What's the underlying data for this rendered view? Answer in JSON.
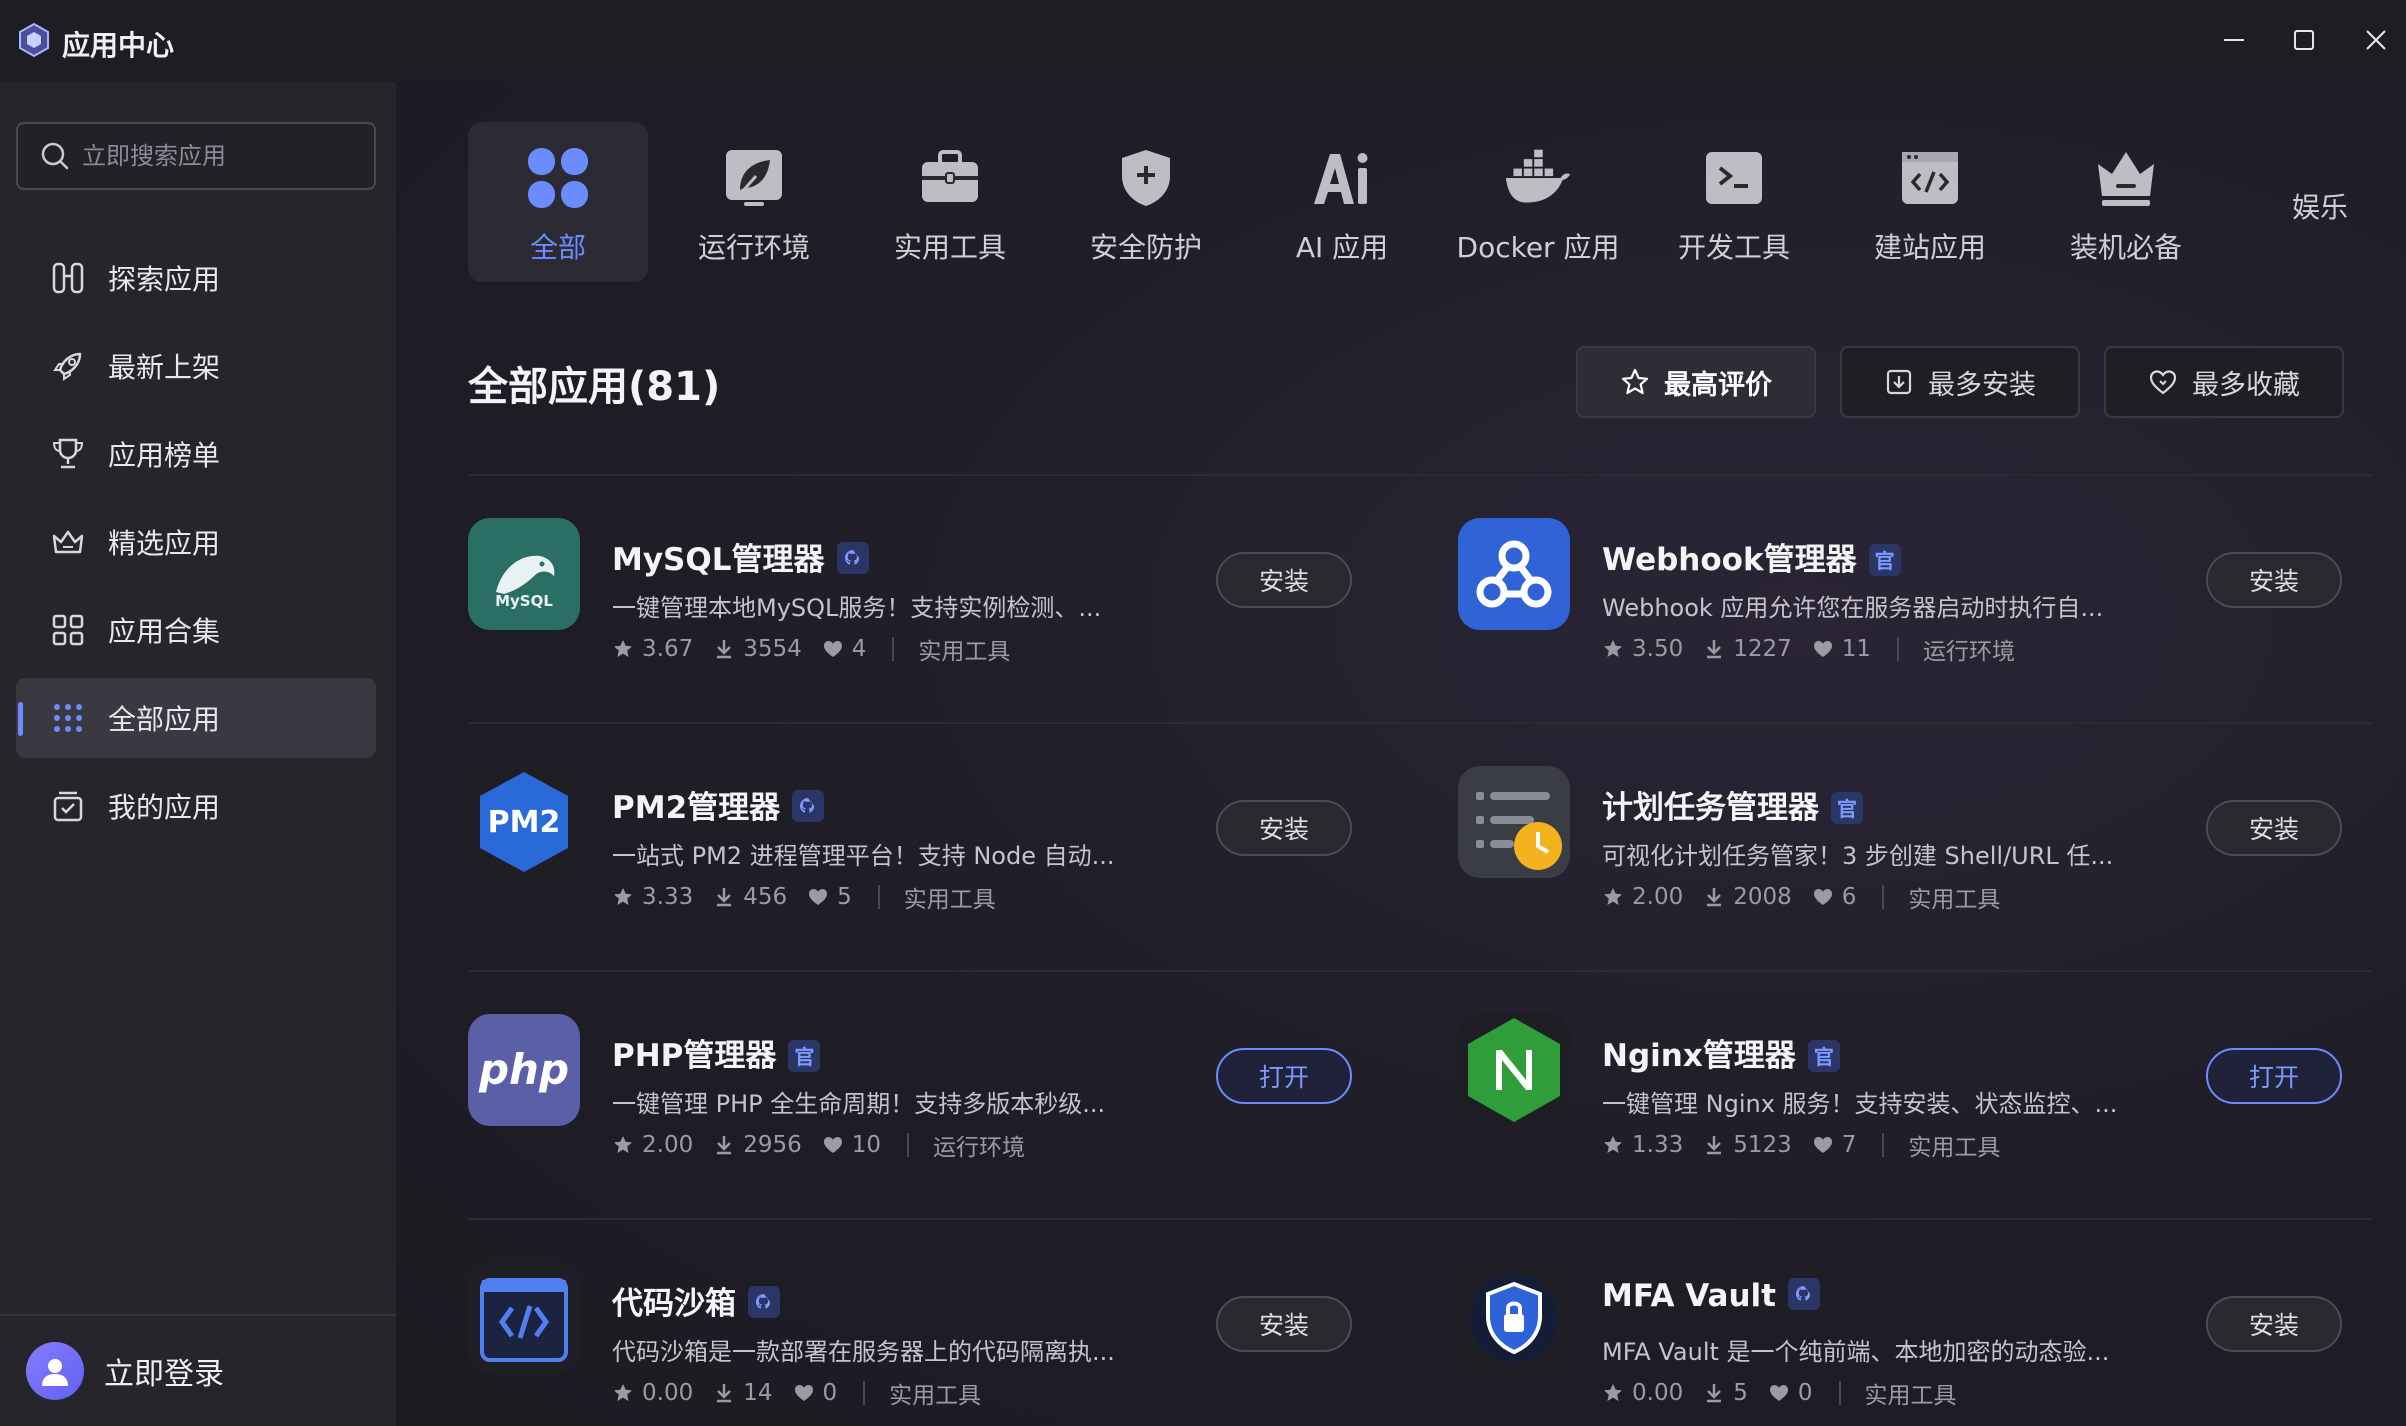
{
  "window": {
    "title": "应用中心"
  },
  "search": {
    "placeholder": "立即搜索应用"
  },
  "sidebar": {
    "items": [
      {
        "label": "探索应用",
        "icon": "explore-icon"
      },
      {
        "label": "最新上架",
        "icon": "rocket-icon"
      },
      {
        "label": "应用榜单",
        "icon": "trophy-icon"
      },
      {
        "label": "精选应用",
        "icon": "crown-basket-icon"
      },
      {
        "label": "应用合集",
        "icon": "grid-icon"
      },
      {
        "label": "全部应用",
        "icon": "dots-grid-icon",
        "active": true
      },
      {
        "label": "我的应用",
        "icon": "my-apps-icon"
      }
    ],
    "login_label": "立即登录"
  },
  "categories": [
    {
      "label": "全部",
      "icon": "clover-icon",
      "active": true
    },
    {
      "label": "运行环境",
      "icon": "leaf-icon"
    },
    {
      "label": "实用工具",
      "icon": "toolbox-icon"
    },
    {
      "label": "安全防护",
      "icon": "shield-icon"
    },
    {
      "label": "AI 应用",
      "icon": "ai-icon"
    },
    {
      "label": "Docker 应用",
      "icon": "docker-icon"
    },
    {
      "label": "开发工具",
      "icon": "terminal-icon"
    },
    {
      "label": "建站应用",
      "icon": "code-window-icon"
    },
    {
      "label": "装机必备",
      "icon": "crown-icon"
    }
  ],
  "categories_more": "娱乐",
  "section": {
    "title": "全部应用(81)"
  },
  "sort": {
    "top_rated": "最高评价",
    "most_installed": "最多安装",
    "most_favorited": "最多收藏"
  },
  "apps": [
    {
      "name": "MySQL管理器",
      "badge": "github",
      "desc": "一键管理本地MySQL服务！支持实例检测、...",
      "rating": "3.67",
      "installs": "3554",
      "likes": "4",
      "category": "实用工具",
      "action": "安装"
    },
    {
      "name": "Webhook管理器",
      "badge": "官",
      "desc": "Webhook 应用允许您在服务器启动时执行自...",
      "rating": "3.50",
      "installs": "1227",
      "likes": "11",
      "category": "运行环境",
      "action": "安装"
    },
    {
      "name": "PM2管理器",
      "badge": "github",
      "desc": "一站式 PM2 进程管理平台！支持 Node 自动...",
      "rating": "3.33",
      "installs": "456",
      "likes": "5",
      "category": "实用工具",
      "action": "安装"
    },
    {
      "name": "计划任务管理器",
      "badge": "官",
      "desc": "可视化计划任务管家！3 步创建 Shell/URL 任...",
      "rating": "2.00",
      "installs": "2008",
      "likes": "6",
      "category": "实用工具",
      "action": "安装"
    },
    {
      "name": "PHP管理器",
      "badge": "官",
      "desc": "一键管理 PHP 全生命周期！支持多版本秒级...",
      "rating": "2.00",
      "installs": "2956",
      "likes": "10",
      "category": "运行环境",
      "action": "打开"
    },
    {
      "name": "Nginx管理器",
      "badge": "官",
      "desc": "一键管理 Nginx 服务！支持安装、状态监控、...",
      "rating": "1.33",
      "installs": "5123",
      "likes": "7",
      "category": "实用工具",
      "action": "打开"
    },
    {
      "name": "代码沙箱",
      "badge": "github",
      "desc": "代码沙箱是一款部署在服务器上的代码隔离执...",
      "rating": "0.00",
      "installs": "14",
      "likes": "0",
      "category": "实用工具",
      "action": "安装"
    },
    {
      "name": "MFA Vault",
      "badge": "github",
      "desc": "MFA Vault 是一个纯前端、本地加密的动态验...",
      "rating": "0.00",
      "installs": "5",
      "likes": "0",
      "category": "实用工具",
      "action": "安装"
    }
  ],
  "colors": {
    "accent": "#6b8cff",
    "background": "#1c1b22",
    "sidebar": "#26252c"
  }
}
